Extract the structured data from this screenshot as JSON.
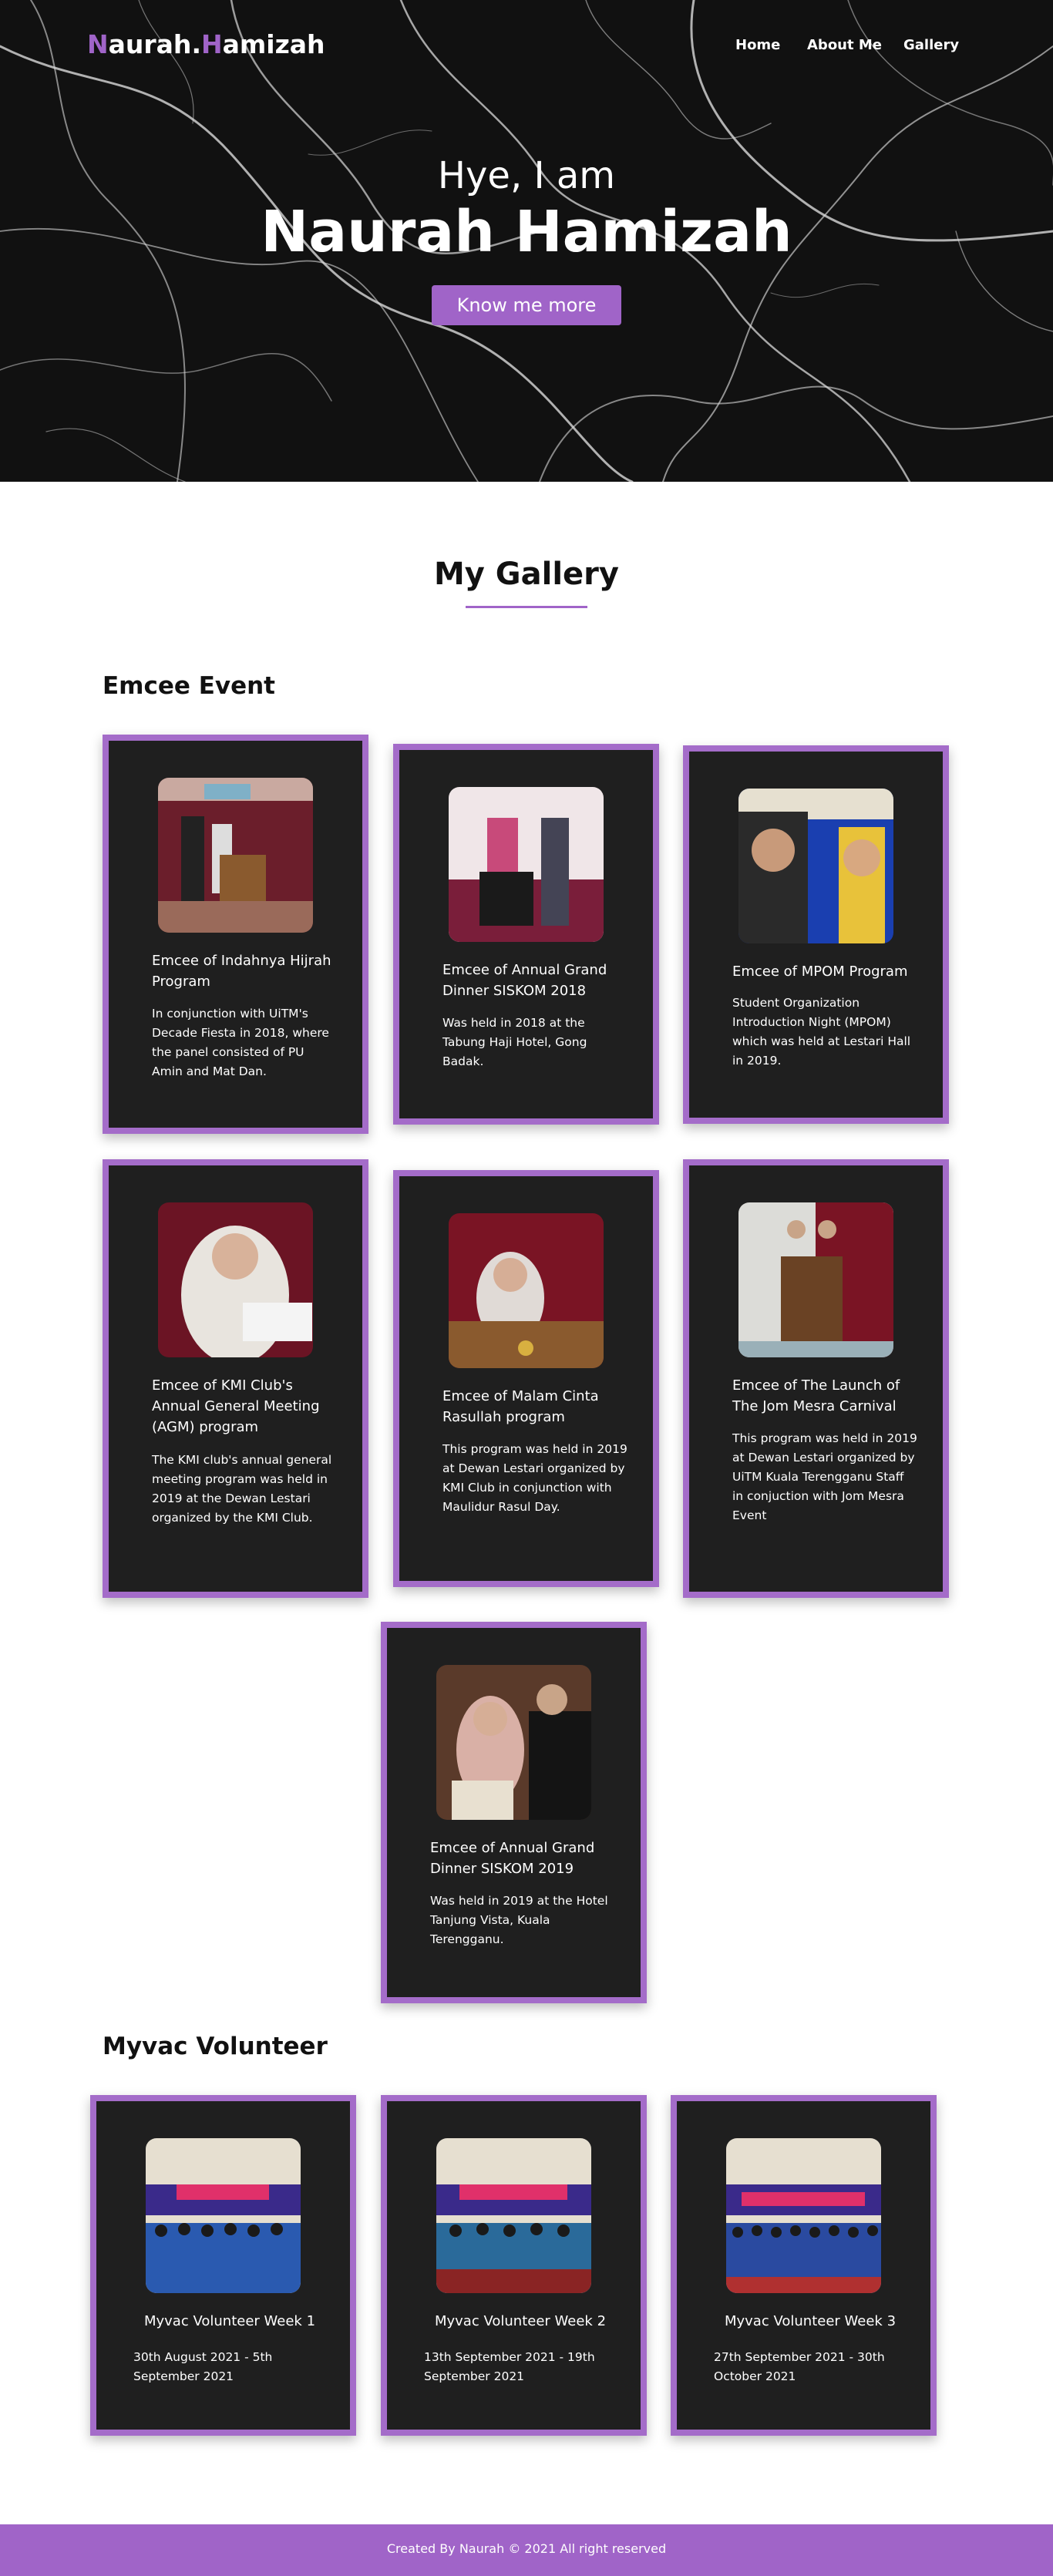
{
  "nav": {
    "logo_n": "N",
    "logo_aurah": "aurah",
    "logo_dot": ".",
    "logo_h": "H",
    "logo_amizah": "amizah",
    "links": [
      "Home",
      "About Me",
      "Gallery"
    ]
  },
  "hero": {
    "greeting": "Hye, I am",
    "name": "Naurah Hamizah",
    "button": "Know me more"
  },
  "gallery": {
    "title": "My Gallery",
    "sections": [
      {
        "heading": "Emcee Event",
        "cards": [
          {
            "title": "Emcee of Indahnya Hijrah Program",
            "description": "In conjunction with UiTM's Decade Fiesta in 2018, where the panel consisted of PU Amin and Mat Dan."
          },
          {
            "title": "Emcee of Annual Grand Dinner SISKOM 2018",
            "description": "Was held in 2018 at the Tabung Haji Hotel, Gong Badak."
          },
          {
            "title": "Emcee of MPOM Program",
            "description": "Student Organization Introduction Night (MPOM) which was held at Lestari Hall in 2019."
          },
          {
            "title": "Emcee of KMI Club's Annual General Meeting (AGM) program",
            "description": "The KMI club's annual general meeting program was held in 2019 at the Dewan Lestari organized by the KMI Club."
          },
          {
            "title": "Emcee of Malam Cinta Rasullah program",
            "description": "This program was held in 2019 at Dewan Lestari organized by KMI Club in conjunction with Maulidur Rasul Day."
          },
          {
            "title": "Emcee of The Launch of The Jom Mesra Carnival",
            "description": "This program was held in 2019 at Dewan Lestari organized by UiTM Kuala Terengganu Staff in conjuction with Jom Mesra Event"
          },
          {
            "title": "Emcee of Annual Grand Dinner SISKOM 2019",
            "description": "Was held in 2019 at the Hotel Tanjung Vista, Kuala Terengganu."
          }
        ]
      },
      {
        "heading": "Myvac Volunteer",
        "cards": [
          {
            "title": "Myvac Volunteer Week 1",
            "description": "30th August 2021 - 5th September 2021"
          },
          {
            "title": "Myvac Volunteer Week 2",
            "description": "13th September 2021 - 19th September 2021"
          },
          {
            "title": "Myvac Volunteer Week 3",
            "description": "27th September 2021 - 30th October 2021"
          }
        ]
      }
    ]
  },
  "footer": {
    "text": "Created By Naurah © 2021 All right reserved"
  },
  "colors": {
    "accent": "#a064c8",
    "card_bg": "#1f1f1f",
    "card_border": "#a46cc9"
  }
}
